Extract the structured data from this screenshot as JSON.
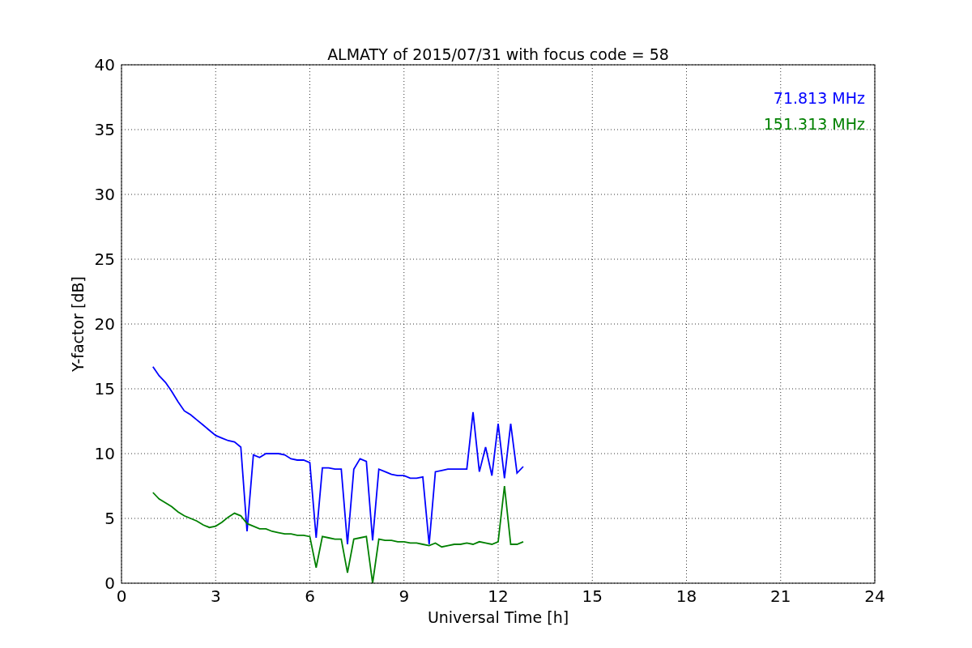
{
  "chart_data": {
    "type": "line",
    "title": "ALMATY of 2015/07/31 with focus code = 58",
    "xlabel": "Universal Time [h]",
    "ylabel": "Y-factor [dB]",
    "x": [
      1.0,
      1.2,
      1.4,
      1.6,
      1.8,
      2.0,
      2.2,
      2.4,
      2.6,
      2.8,
      3.0,
      3.2,
      3.4,
      3.6,
      3.8,
      4.0,
      4.2,
      4.4,
      4.6,
      4.8,
      5.0,
      5.2,
      5.4,
      5.6,
      5.8,
      6.0,
      6.2,
      6.4,
      6.6,
      6.8,
      7.0,
      7.2,
      7.4,
      7.6,
      7.8,
      8.0,
      8.2,
      8.4,
      8.6,
      8.8,
      9.0,
      9.2,
      9.4,
      9.6,
      9.8,
      10.0,
      10.2,
      10.4,
      10.6,
      10.8,
      11.0,
      11.2,
      11.4,
      11.6,
      11.8,
      12.0,
      12.2,
      12.4,
      12.6,
      12.8
    ],
    "series": [
      {
        "name": "71.813 MHz",
        "color": "#0000ff",
        "values": [
          16.7,
          16.0,
          15.5,
          14.8,
          14.0,
          13.3,
          13.0,
          12.6,
          12.2,
          11.8,
          11.4,
          11.2,
          11.0,
          10.9,
          10.5,
          4.0,
          9.9,
          9.7,
          10.0,
          10.0,
          10.0,
          9.9,
          9.6,
          9.5,
          9.5,
          9.3,
          3.5,
          8.9,
          8.9,
          8.8,
          8.8,
          3.0,
          8.8,
          9.6,
          9.4,
          3.3,
          8.8,
          8.6,
          8.4,
          8.3,
          8.3,
          8.1,
          8.1,
          8.2,
          3.0,
          8.6,
          8.7,
          8.8,
          8.8,
          8.8,
          8.8,
          13.2,
          8.6,
          10.5,
          8.3,
          12.3,
          8.1,
          12.3,
          8.5,
          9.0
        ]
      },
      {
        "name": "151.313 MHz",
        "color": "#008000",
        "values": [
          7.0,
          6.5,
          6.2,
          5.9,
          5.5,
          5.2,
          5.0,
          4.8,
          4.5,
          4.3,
          4.4,
          4.7,
          5.1,
          5.4,
          5.2,
          4.6,
          4.4,
          4.2,
          4.2,
          4.0,
          3.9,
          3.8,
          3.8,
          3.7,
          3.7,
          3.6,
          1.2,
          3.6,
          3.5,
          3.4,
          3.4,
          0.8,
          3.4,
          3.5,
          3.6,
          0.0,
          3.4,
          3.3,
          3.3,
          3.2,
          3.2,
          3.1,
          3.1,
          3.0,
          2.9,
          3.1,
          2.8,
          2.9,
          3.0,
          3.0,
          3.1,
          3.0,
          3.2,
          3.1,
          3.0,
          3.2,
          7.5,
          3.0,
          3.0,
          3.2
        ]
      }
    ],
    "xlim": [
      0,
      24
    ],
    "ylim": [
      0,
      40
    ],
    "xticks": [
      0,
      3,
      6,
      9,
      12,
      15,
      18,
      21,
      24
    ],
    "yticks": [
      0,
      5,
      10,
      15,
      20,
      25,
      30,
      35,
      40
    ],
    "grid": true
  }
}
